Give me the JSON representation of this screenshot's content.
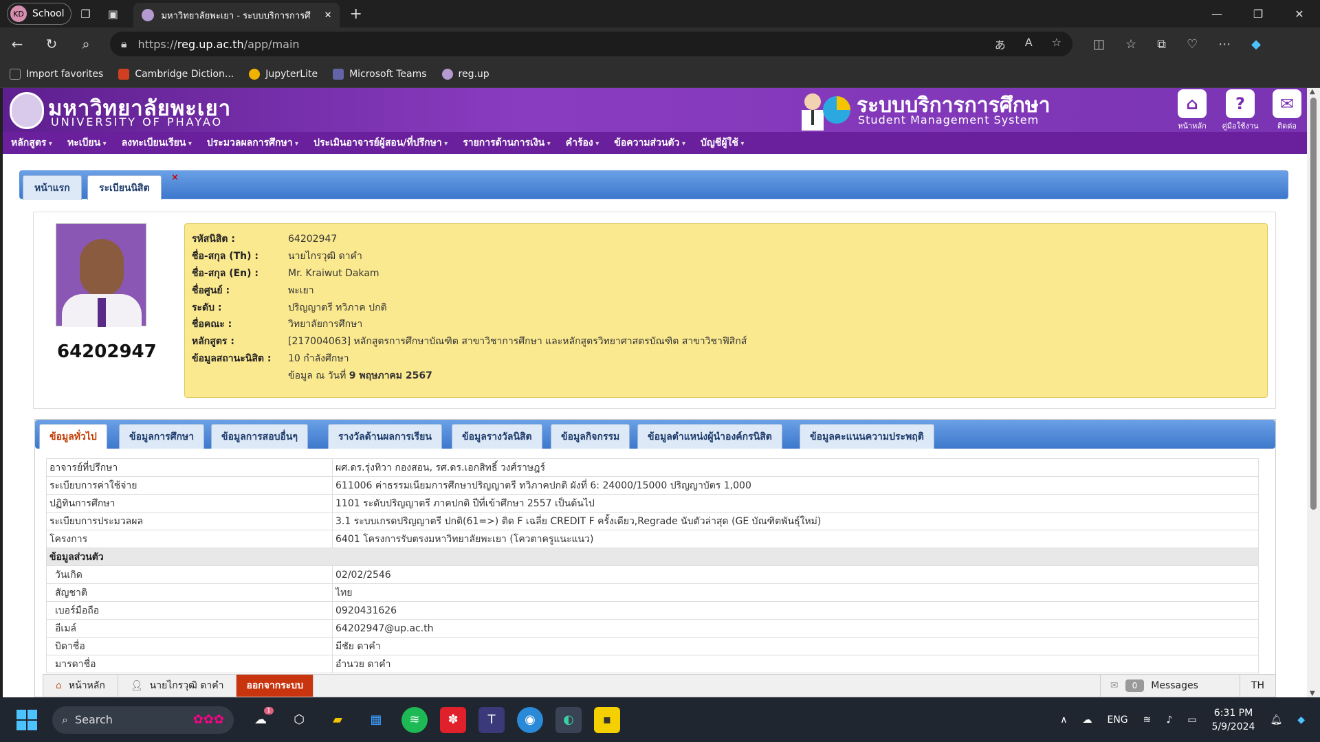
{
  "browser": {
    "profile_initials": "KD",
    "profile_name": "School",
    "tab_title": "มหาวิทยาลัยพะเยา - ระบบบริการการศึ",
    "url_prefix": "https://",
    "url_host": "reg.up.ac.th",
    "url_path": "/app/main",
    "favorites": [
      {
        "label": "Import favorites",
        "color": "#666666"
      },
      {
        "label": "Cambridge Diction...",
        "color": "#d04020"
      },
      {
        "label": "JupyterLite",
        "color": "#f0b400"
      },
      {
        "label": "Microsoft Teams",
        "color": "#6264a7"
      },
      {
        "label": "reg.up",
        "color": "#b59ad1"
      }
    ]
  },
  "header": {
    "uni_th": "มหาวิทยาลัยพะเยา",
    "uni_en": "UNIVERSITY OF PHAYAO",
    "system_th": "ระบบบริการการศึกษา",
    "system_en": "Student Management System",
    "home_label": "หน้าหลัก",
    "manual_label": "คู่มือใช้งาน",
    "contact_label": "ติดต่อ"
  },
  "menu": [
    "หลักสูตร",
    "ทะเบียน",
    "ลงทะเบียนเรียน",
    "ประมวลผลการศึกษา",
    "ประเมินอาจารย์ผู้สอน/ที่ปรึกษา",
    "รายการด้านการเงิน",
    "คำร้อง",
    "ข้อความส่วนตัว",
    "บัญชีผู้ใช้"
  ],
  "page_tabs": {
    "home": "หน้าแรก",
    "registry": "ระเบียนนิสิต",
    "close": "×"
  },
  "student": {
    "id_big": "64202947",
    "fields": [
      {
        "k": "รหัสนิสิต :",
        "v": "64202947"
      },
      {
        "k": "ชื่อ-สกุล (Th) :",
        "v": "นายไกรวุฒิ ดาคำ"
      },
      {
        "k": "ชื่อ-สกุล (En) :",
        "v": "Mr. Kraiwut Dakam"
      },
      {
        "k": "ชื่อศูนย์ :",
        "v": "พะเยา"
      },
      {
        "k": "ระดับ :",
        "v": "ปริญญาตรี ทวิภาค ปกติ"
      },
      {
        "k": "ชื่อคณะ :",
        "v": "วิทยาลัยการศึกษา"
      },
      {
        "k": "หลักสูตร :",
        "v": "[217004063] หลักสูตรการศึกษาบัณฑิต สาขาวิชาการศึกษา และหลักสูตรวิทยาศาสตรบัณฑิต สาขาวิชาฟิสิกส์"
      },
      {
        "k": "ข้อมูลสถานะนิสิต :",
        "v": "10 กำลังศึกษา"
      }
    ],
    "asof_prefix": "ข้อมูล ณ วันที่",
    "asof_date": "9 พฤษภาคม 2567"
  },
  "detail_tabs": [
    "ข้อมูลทั่วไป",
    "ข้อมูลการศึกษา",
    "ข้อมูลการสอบอื่นๆ",
    "รางวัลด้านผลการเรียน",
    "ข้อมูลรางวัลนิสิต",
    "ข้อมูลกิจกรรม",
    "ข้อมูลตำแหน่งผู้นำองค์กรนิสิต",
    "ข้อมูลคะแนนความประพฤติ"
  ],
  "details": [
    {
      "k": "อาจารย์ที่ปรึกษา",
      "v": "ผศ.ดร.รุ่งทิวา กองสอน, รศ.ดร.เอกสิทธิ์ วงศ์ราษฎร์"
    },
    {
      "k": "ระเบียบการค่าใช้จ่าย",
      "v": "611006 ค่าธรรมเนียมการศึกษาปริญญาตรี ทวิภาคปกติ ผังที่ 6: 24000/15000 ปริญญาบัตร 1,000"
    },
    {
      "k": "ปฏิทินการศึกษา",
      "v": "1101 ระดับปริญญาตรี ภาคปกติ ปีที่เข้าศึกษา 2557 เป็นต้นไป"
    },
    {
      "k": "ระเบียบการประมวลผล",
      "v": "3.1 ระบบเกรดปริญญาตรี ปกติ(61=>) ติด F เฉลี่ย CREDIT F ครั้งเดียว,Regrade นับตัวล่าสุด (GE บัณฑิตพันธุ์ใหม่)"
    },
    {
      "k": "โครงการ",
      "v": "6401 โครงการรับตรงมหาวิทยาลัยพะเยา (โควตาครูแนะแนว)"
    }
  ],
  "personal_section": "ข้อมูลส่วนตัว",
  "personal": [
    {
      "k": "วันเกิด",
      "v": "02/02/2546"
    },
    {
      "k": "สัญชาติ",
      "v": "ไทย"
    },
    {
      "k": "เบอร์มือถือ",
      "v": "0920431626"
    },
    {
      "k": "อีเมล์",
      "v": "64202947@up.ac.th"
    },
    {
      "k": "บิดาชื่อ",
      "v": "มีชัย ดาคำ"
    },
    {
      "k": "มารดาชื่อ",
      "v": "อำนวย ดาคำ"
    }
  ],
  "bottombar": {
    "home": "หน้าหลัก",
    "user": "นายไกรวุฒิ ดาคำ",
    "logout": "ออกจากระบบ",
    "msg_count": "0",
    "messages": "Messages",
    "lang": "TH"
  },
  "taskbar": {
    "search": "Search",
    "lang": "ENG",
    "time": "6:31 PM",
    "date": "5/9/2024",
    "badge": "1"
  }
}
